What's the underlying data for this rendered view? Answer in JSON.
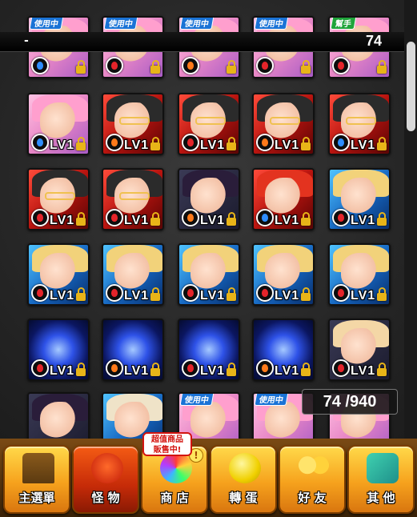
{
  "header": {
    "left_text": "-",
    "count": "74"
  },
  "box_count": "74 /940",
  "tags": {
    "in_use": "使用中",
    "helper": "幫手"
  },
  "level_label": "LV1",
  "promo": "超值商品\n販售中!",
  "nav": {
    "main_menu": "主選單",
    "monster": "怪 物",
    "shop": "商 店",
    "gacha": "轉 蛋",
    "friends": "好 友",
    "other": "其 他",
    "alert": "!"
  },
  "colors": {
    "fire": "#ff7a1a",
    "water": "#2e8dff",
    "wood_apple": "#e5242a",
    "lock": "#e8b418",
    "nav_gold": "#f6a21d",
    "nav_active": "#c62b08"
  },
  "icons": [
    "fire-element-icon",
    "water-element-icon",
    "apple-element-icon",
    "lock-icon"
  ]
}
